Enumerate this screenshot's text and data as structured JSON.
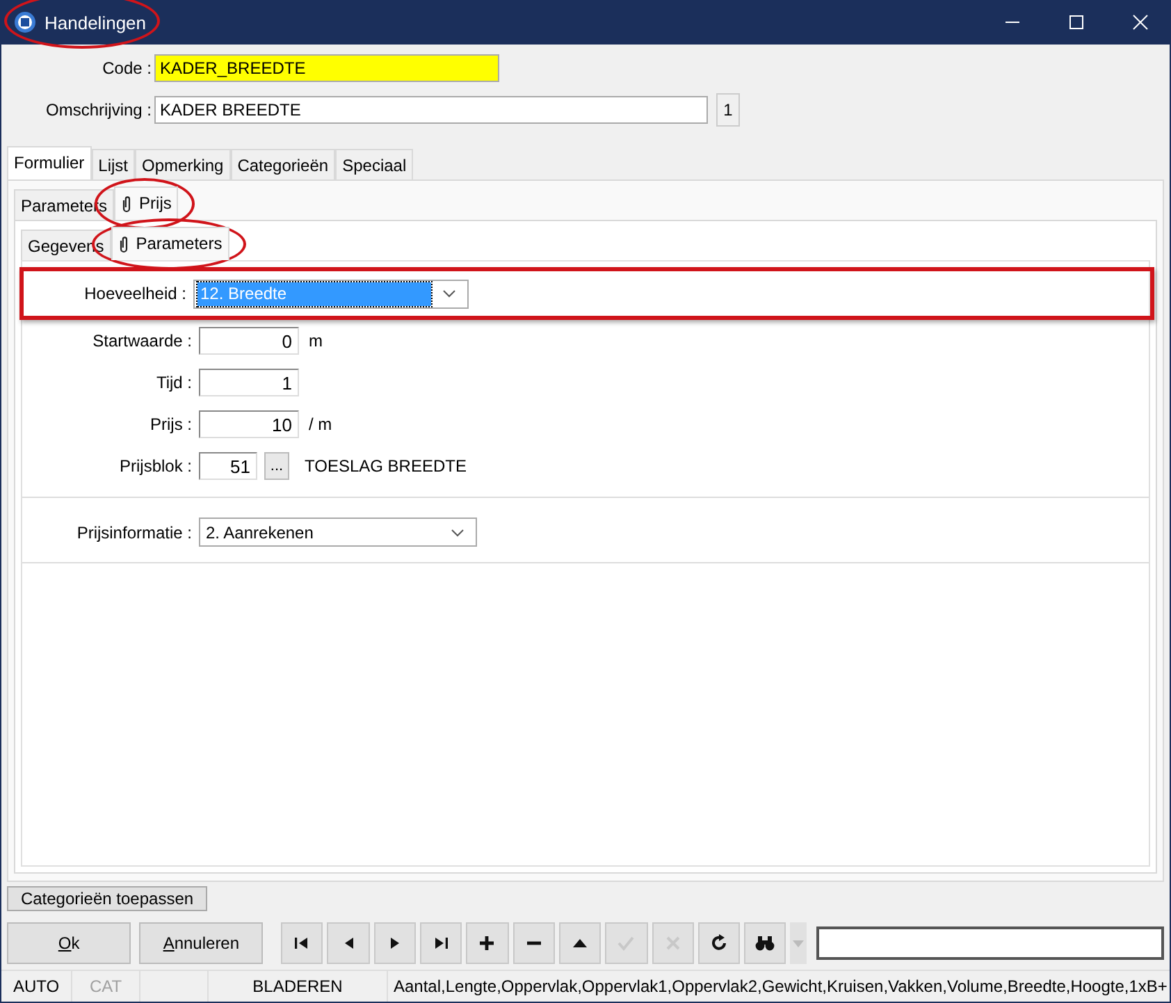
{
  "window": {
    "title": "Handelingen",
    "highlighted": true
  },
  "header": {
    "code": {
      "label": "Code :",
      "value": "KADER_BREEDTE",
      "required": true
    },
    "description": {
      "label": "Omschrijving :",
      "value": "KADER BREEDTE",
      "counter": "1"
    }
  },
  "tabs": [
    {
      "label": "Formulier",
      "selected": true
    },
    {
      "label": "Lijst",
      "selected": false
    },
    {
      "label": "Opmerking",
      "selected": false
    },
    {
      "label": "Categorieën",
      "selected": false
    },
    {
      "label": "Speciaal",
      "selected": false
    }
  ],
  "subtabs": [
    {
      "label": "Parameters",
      "selected": false,
      "attachment": false,
      "highlighted": false
    },
    {
      "label": "Prijs",
      "selected": true,
      "attachment": true,
      "highlighted": true
    }
  ],
  "inner_tabs": [
    {
      "label": "Gegevens",
      "selected": false,
      "attachment": false,
      "highlighted": false
    },
    {
      "label": "Parameters",
      "selected": true,
      "attachment": true,
      "highlighted": true
    }
  ],
  "form": [
    {
      "kind": "select",
      "label": "Hoeveelheid :",
      "value": "12. Breedte",
      "focused": true,
      "highlighted": true
    },
    {
      "kind": "number",
      "label": "Startwaarde :",
      "value": "0",
      "unit": "m",
      "highlighted": false
    },
    {
      "kind": "number",
      "label": "Tijd :",
      "value": "1",
      "highlighted": false
    },
    {
      "kind": "number",
      "label": "Prijs :",
      "value": "10",
      "unit": "/ m",
      "highlighted": false
    },
    {
      "kind": "lookup",
      "label": "Prijsblok :",
      "value": "51",
      "button": "...",
      "note": "TOESLAG BREEDTE",
      "highlighted": false
    }
  ],
  "price_info": {
    "label": "Prijsinformatie :",
    "value": "2. Aanrekenen"
  },
  "apply_button": "Categorieën toepassen",
  "buttons": [
    {
      "label": "Ok",
      "underline_first": true
    },
    {
      "label": "Annuleren",
      "underline_first": true
    }
  ],
  "toolbar": [
    {
      "kind": "first",
      "disabled": false
    },
    {
      "kind": "prev",
      "disabled": false
    },
    {
      "kind": "next",
      "disabled": false
    },
    {
      "kind": "last",
      "disabled": false
    },
    {
      "kind": "add",
      "disabled": false
    },
    {
      "kind": "remove",
      "disabled": false
    },
    {
      "kind": "up",
      "disabled": false
    },
    {
      "kind": "confirm",
      "disabled": true
    },
    {
      "kind": "cancel",
      "disabled": true
    },
    {
      "kind": "refresh",
      "disabled": false
    },
    {
      "kind": "find",
      "disabled": false
    },
    {
      "kind": "dropdown",
      "disabled": true
    }
  ],
  "status_bar": [
    {
      "text": "AUTO",
      "disabled": false,
      "gap_before": false
    },
    {
      "text": "CAT",
      "disabled": true,
      "gap_before": false
    },
    {
      "text": "BLADEREN",
      "disabled": false,
      "gap_before": true
    },
    {
      "text": "Aantal,Lengte,Oppervlak,Oppervlak1,Oppervlak2,Gewicht,Kruisen,Vakken,Volume,Breedte,Hoogte,1xB+",
      "disabled": false,
      "gap_before": false
    }
  ]
}
